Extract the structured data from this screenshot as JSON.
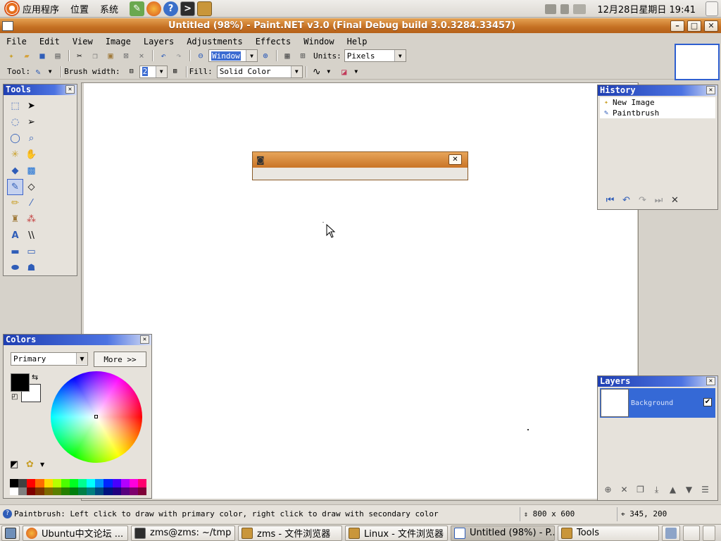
{
  "top_panel": {
    "menus": [
      "应用程序",
      "位置",
      "系统"
    ],
    "clock": "12月28日星期日 19:41"
  },
  "window": {
    "title": "Untitled (98%) - Paint.NET v3.0 (Final Debug build 3.0.3284.33457)",
    "min_label": "–",
    "max_label": "□",
    "close_label": "✕"
  },
  "menubar": [
    "File",
    "Edit",
    "View",
    "Image",
    "Layers",
    "Adjustments",
    "Effects",
    "Window",
    "Help"
  ],
  "toolbar": {
    "zoom_value": "Window",
    "units_label": "Units:",
    "units_value": "Pixels",
    "tool_label": "Tool:",
    "brush_width_label": "Brush width:",
    "brush_width_value": "2",
    "fill_label": "Fill:",
    "fill_value": "Solid Color"
  },
  "tools_panel": {
    "title": "Tools",
    "close": "✕"
  },
  "history_panel": {
    "title": "History",
    "close": "✕",
    "items": [
      "New Image",
      "Paintbrush"
    ]
  },
  "layers_panel": {
    "title": "Layers",
    "close": "✕",
    "layers": [
      {
        "name": "Background",
        "visible": true
      }
    ]
  },
  "colors_panel": {
    "title": "Colors",
    "close": "✕",
    "mode_value": "Primary",
    "more_label": "More >>"
  },
  "shot_dialog": {
    "close": "✕"
  },
  "statusbar": {
    "message": "Paintbrush: Left click to draw with primary color, right click to draw with secondary color",
    "image_size": "800 x 600",
    "cursor_pos": "345, 200"
  },
  "taskbar": {
    "items": [
      {
        "label": "Ubuntu中文论坛 ...",
        "active": false
      },
      {
        "label": "zms@zms: ~/tmp",
        "active": false
      },
      {
        "label": "zms - 文件浏览器",
        "active": false
      },
      {
        "label": "Linux - 文件浏览器",
        "active": false
      },
      {
        "label": "Untitled (98%) - P...",
        "active": true
      },
      {
        "label": "Tools",
        "active": false
      }
    ]
  },
  "colors": {
    "titlebar_accent": "#c46f22",
    "panel_header": "#1f3fb2",
    "layer_selected": "#3569d6"
  }
}
